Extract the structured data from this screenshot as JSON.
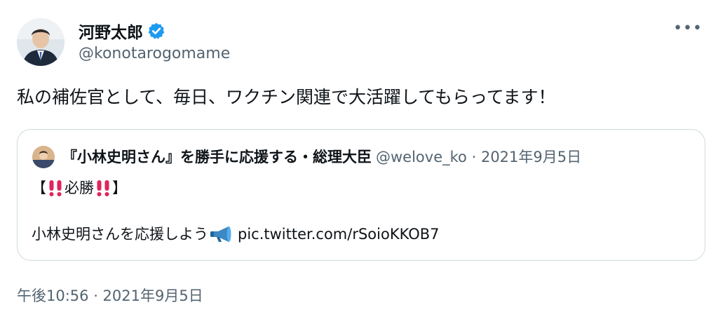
{
  "author": {
    "name": "河野太郎",
    "handle": "@konotarogomame"
  },
  "tweet": {
    "text": "私の補佐官として、毎日、ワクチン関連で大活躍してもらってます！",
    "timestamp": "午後10:56 · 2021年9月5日"
  },
  "quote": {
    "name": "『小林史明さん』を勝手に応援する・総理大臣",
    "handle": "@welove_ko",
    "separator": "·",
    "date": "2021年9月5日",
    "line1_prefix": "【",
    "line1_word": "必勝",
    "line1_suffix": "】",
    "line2_text": "小林史明さんを応援しよう",
    "line2_link": "pic.twitter.com/rSoioKKOB7"
  },
  "ui": {
    "more_label": "•••"
  },
  "colors": {
    "verified_blue": "#1d9bf0",
    "secondary_text": "#536471",
    "border": "#cfd9de",
    "emoji_red": "#e0245e"
  }
}
